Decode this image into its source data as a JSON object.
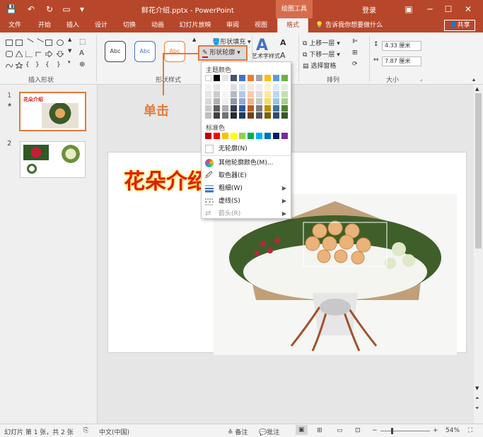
{
  "window": {
    "title": "鲜花介绍.pptx - PowerPoint",
    "context_tab": "绘图工具",
    "login": "登录"
  },
  "menu": {
    "tabs": [
      "文件",
      "开始",
      "插入",
      "设计",
      "切换",
      "动画",
      "幻灯片放映",
      "审阅",
      "视图",
      "格式"
    ],
    "tell_me": "告诉我你想要做什么",
    "share": "共享"
  },
  "ribbon": {
    "groups": {
      "insert_shapes": "插入形状",
      "shape_styles": "形状样式",
      "arrange": "排列",
      "size": "大小"
    },
    "style_box_label": "Abc",
    "shape_fill": "形状填充",
    "shape_outline": "形状轮廓",
    "art_styles": "艺术字样式",
    "bring_forward": "上移一层",
    "send_backward": "下移一层",
    "selection_pane": "选择窗格",
    "height": "4.33 厘米",
    "width": "7.87 厘米"
  },
  "dropdown": {
    "theme_colors_label": "主题颜色",
    "standard_colors_label": "标准色",
    "no_outline": "无轮廓(N)",
    "more_colors": "其他轮廓颜色(M)...",
    "eyedropper": "取色器(E)",
    "weight": "粗细(W)",
    "dashes": "虚线(S)",
    "arrows": "箭头(R)",
    "theme_top_row": [
      "#ffffff",
      "#000000",
      "#e7e6e6",
      "#44546a",
      "#4472c4",
      "#ed7d31",
      "#a5a5a5",
      "#ffc000",
      "#5b9bd5",
      "#70ad47"
    ],
    "standard_colors": [
      "#c00000",
      "#ff0000",
      "#ffc000",
      "#ffff00",
      "#92d050",
      "#00b050",
      "#00b0f0",
      "#0070c0",
      "#002060",
      "#7030a0"
    ]
  },
  "annotation": {
    "callout": "单击"
  },
  "slides": {
    "thumb1_title": "花朵介绍",
    "numbers": [
      "1",
      "2"
    ],
    "main_title": "花朵介绍"
  },
  "statusbar": {
    "slide_info": "幻灯片 第 1 张，共 2 张",
    "language": "中文(中国)",
    "notes": "备注",
    "comments": "批注",
    "zoom": "54%"
  },
  "colors": {
    "accent": "#b7472a",
    "highlight": "#e07a3c"
  }
}
